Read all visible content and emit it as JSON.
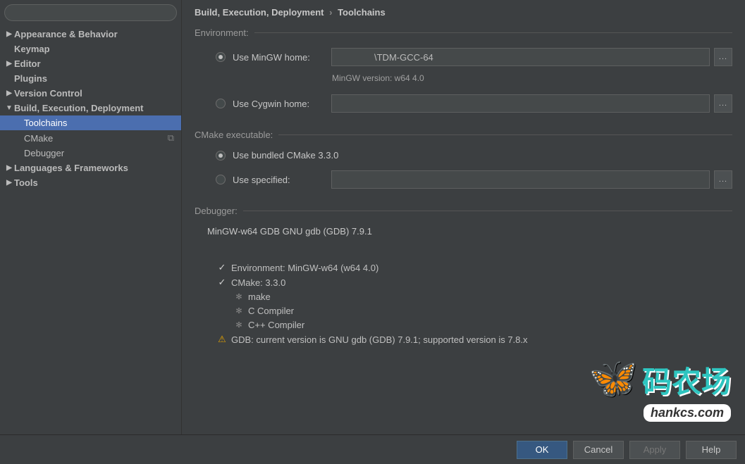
{
  "sidebar": {
    "search_placeholder": "",
    "items": [
      {
        "label": "Appearance & Behavior",
        "expandable": true
      },
      {
        "label": "Keymap",
        "expandable": false
      },
      {
        "label": "Editor",
        "expandable": true
      },
      {
        "label": "Plugins",
        "expandable": false
      },
      {
        "label": "Version Control",
        "expandable": true
      },
      {
        "label": "Build, Execution, Deployment",
        "expandable": true,
        "open": true
      },
      {
        "label": "Toolchains",
        "child": true,
        "selected": true
      },
      {
        "label": "CMake",
        "child": true,
        "copy": true
      },
      {
        "label": "Debugger",
        "child": true
      },
      {
        "label": "Languages & Frameworks",
        "expandable": true
      },
      {
        "label": "Tools",
        "expandable": true
      }
    ]
  },
  "breadcrumb": {
    "root": "Build, Execution, Deployment",
    "sep": "›",
    "leaf": "Toolchains"
  },
  "sections": {
    "env": "Environment:",
    "cmake": "CMake executable:",
    "debugger": "Debugger:"
  },
  "env": {
    "mingw_label": "Use MinGW home:",
    "mingw_value": "\\TDM-GCC-64",
    "mingw_note": "MinGW version: w64 4.0",
    "cygwin_label": "Use Cygwin home:",
    "cygwin_value": ""
  },
  "cmake": {
    "bundled_label": "Use bundled CMake 3.3.0",
    "specified_label": "Use specified:",
    "specified_value": ""
  },
  "debugger": {
    "value": "MinGW-w64 GDB GNU gdb (GDB) 7.9.1"
  },
  "status": {
    "env_ok": "Environment: MinGW-w64 (w64 4.0)",
    "cmake_ok": "CMake: 3.3.0",
    "make": "make",
    "cc": "C Compiler",
    "cxx": "C++ Compiler",
    "gdb_warn": "GDB: current version is GNU gdb (GDB) 7.9.1; supported version is 7.8.x"
  },
  "buttons": {
    "ok": "OK",
    "cancel": "Cancel",
    "apply": "Apply",
    "help": "Help",
    "browse": "..."
  },
  "watermark": {
    "logo": "码农场",
    "url": "hankcs.com"
  }
}
